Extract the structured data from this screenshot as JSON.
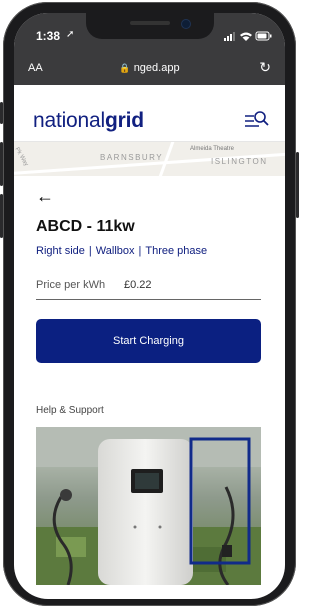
{
  "status_bar": {
    "time": "1:38"
  },
  "browser": {
    "text_size_label": "AA",
    "url": "nged.app"
  },
  "header": {
    "logo_regular": "national",
    "logo_bold": "grid"
  },
  "map": {
    "area_1": "BARNSBURY",
    "area_2": "ISLINGTON",
    "poi": "Almeida Theatre",
    "road": "Pk Way"
  },
  "charger": {
    "name": "ABCD - 11kw",
    "tags": [
      "Right side",
      "Wallbox",
      "Three phase"
    ],
    "price_label": "Price per kWh",
    "price_value": "£0.22"
  },
  "actions": {
    "start_label": "Start Charging"
  },
  "help": {
    "title": "Help & Support"
  },
  "colors": {
    "brand_navy": "#0b2081",
    "status_bar": "#3b3b3d",
    "highlight_box": "#112b8a"
  }
}
